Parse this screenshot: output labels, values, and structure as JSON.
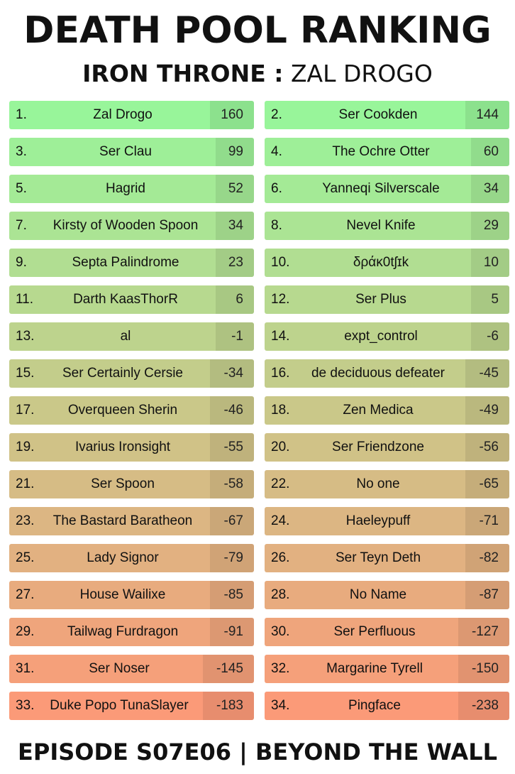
{
  "header": {
    "title": "DEATH POOL RANKING",
    "subtitle_bold": "IRON THRONE :",
    "subtitle_light": "ZAL DROGO"
  },
  "footer": {
    "text": "EPISODE S07E06 | BEYOND THE WALL"
  },
  "colors": {
    "top": "#98f59a",
    "bottom": "#fb9a78"
  },
  "rankings": [
    {
      "rank": "1.",
      "name": "Zal Drogo",
      "score": "160"
    },
    {
      "rank": "2.",
      "name": "Ser Cookden",
      "score": "144"
    },
    {
      "rank": "3.",
      "name": "Ser Clau",
      "score": "99"
    },
    {
      "rank": "4.",
      "name": "The Ochre Otter",
      "score": "60"
    },
    {
      "rank": "5.",
      "name": "Hagrid",
      "score": "52"
    },
    {
      "rank": "6.",
      "name": "Yanneqi Silverscale",
      "score": "34"
    },
    {
      "rank": "7.",
      "name": "Kirsty of Wooden Spoon",
      "score": "34"
    },
    {
      "rank": "8.",
      "name": "Nevel Knife",
      "score": "29"
    },
    {
      "rank": "9.",
      "name": "Septa Palindrome",
      "score": "23"
    },
    {
      "rank": "10.",
      "name": "δράκ0tʃɪk",
      "score": "10"
    },
    {
      "rank": "11.",
      "name": "Darth KaasThorR",
      "score": "6"
    },
    {
      "rank": "12.",
      "name": "Ser Plus",
      "score": "5"
    },
    {
      "rank": "13.",
      "name": "al",
      "score": "-1"
    },
    {
      "rank": "14.",
      "name": "expt_control",
      "score": "-6"
    },
    {
      "rank": "15.",
      "name": "Ser Certainly Cersie",
      "score": "-34"
    },
    {
      "rank": "16.",
      "name": "de deciduous defeater",
      "score": "-45"
    },
    {
      "rank": "17.",
      "name": "Overqueen Sherin",
      "score": "-46"
    },
    {
      "rank": "18.",
      "name": "Zen Medica",
      "score": "-49"
    },
    {
      "rank": "19.",
      "name": "Ivarius Ironsight",
      "score": "-55"
    },
    {
      "rank": "20.",
      "name": "Ser Friendzone",
      "score": "-56"
    },
    {
      "rank": "21.",
      "name": "Ser Spoon",
      "score": "-58"
    },
    {
      "rank": "22.",
      "name": "No one",
      "score": "-65"
    },
    {
      "rank": "23.",
      "name": "The Bastard Baratheon",
      "score": "-67"
    },
    {
      "rank": "24.",
      "name": "Haeleypuff",
      "score": "-71"
    },
    {
      "rank": "25.",
      "name": "Lady Signor",
      "score": "-79"
    },
    {
      "rank": "26.",
      "name": "Ser Teyn Deth",
      "score": "-82"
    },
    {
      "rank": "27.",
      "name": "House Wailixe",
      "score": "-85"
    },
    {
      "rank": "28.",
      "name": "No Name",
      "score": "-87"
    },
    {
      "rank": "29.",
      "name": "Tailwag Furdragon",
      "score": "-91"
    },
    {
      "rank": "30.",
      "name": "Ser Perfluous",
      "score": "-127"
    },
    {
      "rank": "31.",
      "name": "Ser Noser",
      "score": "-145"
    },
    {
      "rank": "32.",
      "name": "Margarine Tyrell",
      "score": "-150"
    },
    {
      "rank": "33.",
      "name": "Duke Popo TunaSlayer",
      "score": "-183"
    },
    {
      "rank": "34.",
      "name": "Pingface",
      "score": "-238"
    }
  ]
}
